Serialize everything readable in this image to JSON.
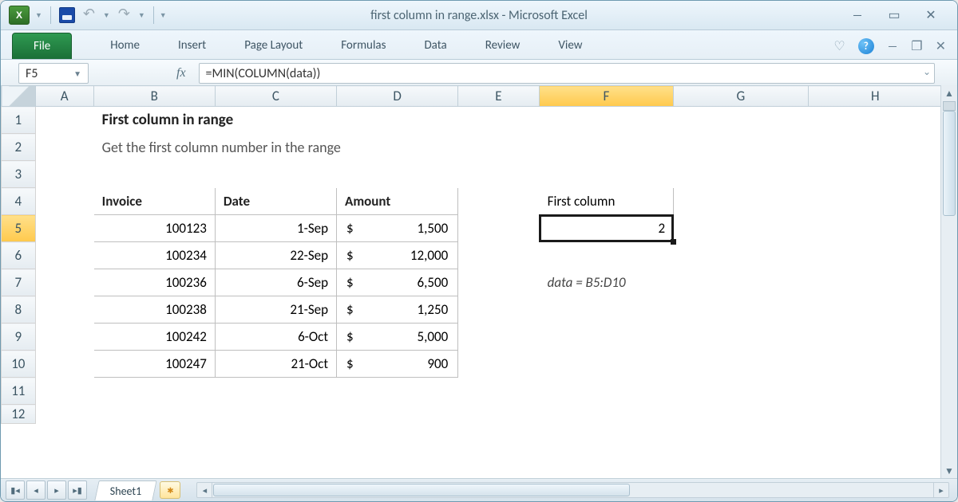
{
  "window": {
    "title": "first column in range.xlsx - Microsoft Excel"
  },
  "ribbon": {
    "file": "File",
    "tabs": [
      "Home",
      "Insert",
      "Page Layout",
      "Formulas",
      "Data",
      "Review",
      "View"
    ]
  },
  "formula_bar": {
    "name_box": "F5",
    "fx_label": "fx",
    "formula": "=MIN(COLUMN(data))"
  },
  "columns": [
    "A",
    "B",
    "C",
    "D",
    "E",
    "F",
    "G",
    "H"
  ],
  "rows": [
    "1",
    "2",
    "3",
    "4",
    "5",
    "6",
    "7",
    "8",
    "9",
    "10",
    "11",
    "12"
  ],
  "content": {
    "b1": "First column in range",
    "b2": "Get the first column number in the range",
    "table_headers": {
      "b4": "Invoice",
      "c4": "Date",
      "d4": "Amount"
    },
    "invoices": [
      "100123",
      "100234",
      "100236",
      "100238",
      "100242",
      "100247"
    ],
    "dates": [
      "1-Sep",
      "22-Sep",
      "6-Sep",
      "21-Sep",
      "6-Oct",
      "21-Oct"
    ],
    "amounts": [
      "1,500",
      "12,000",
      "6,500",
      "1,250",
      "5,000",
      "900"
    ],
    "dollar": "$",
    "f4": "First column",
    "f5": "2",
    "f7": "data = B5:D10"
  },
  "sheet_tab": "Sheet1",
  "selected": {
    "row": "5",
    "col": "F"
  }
}
